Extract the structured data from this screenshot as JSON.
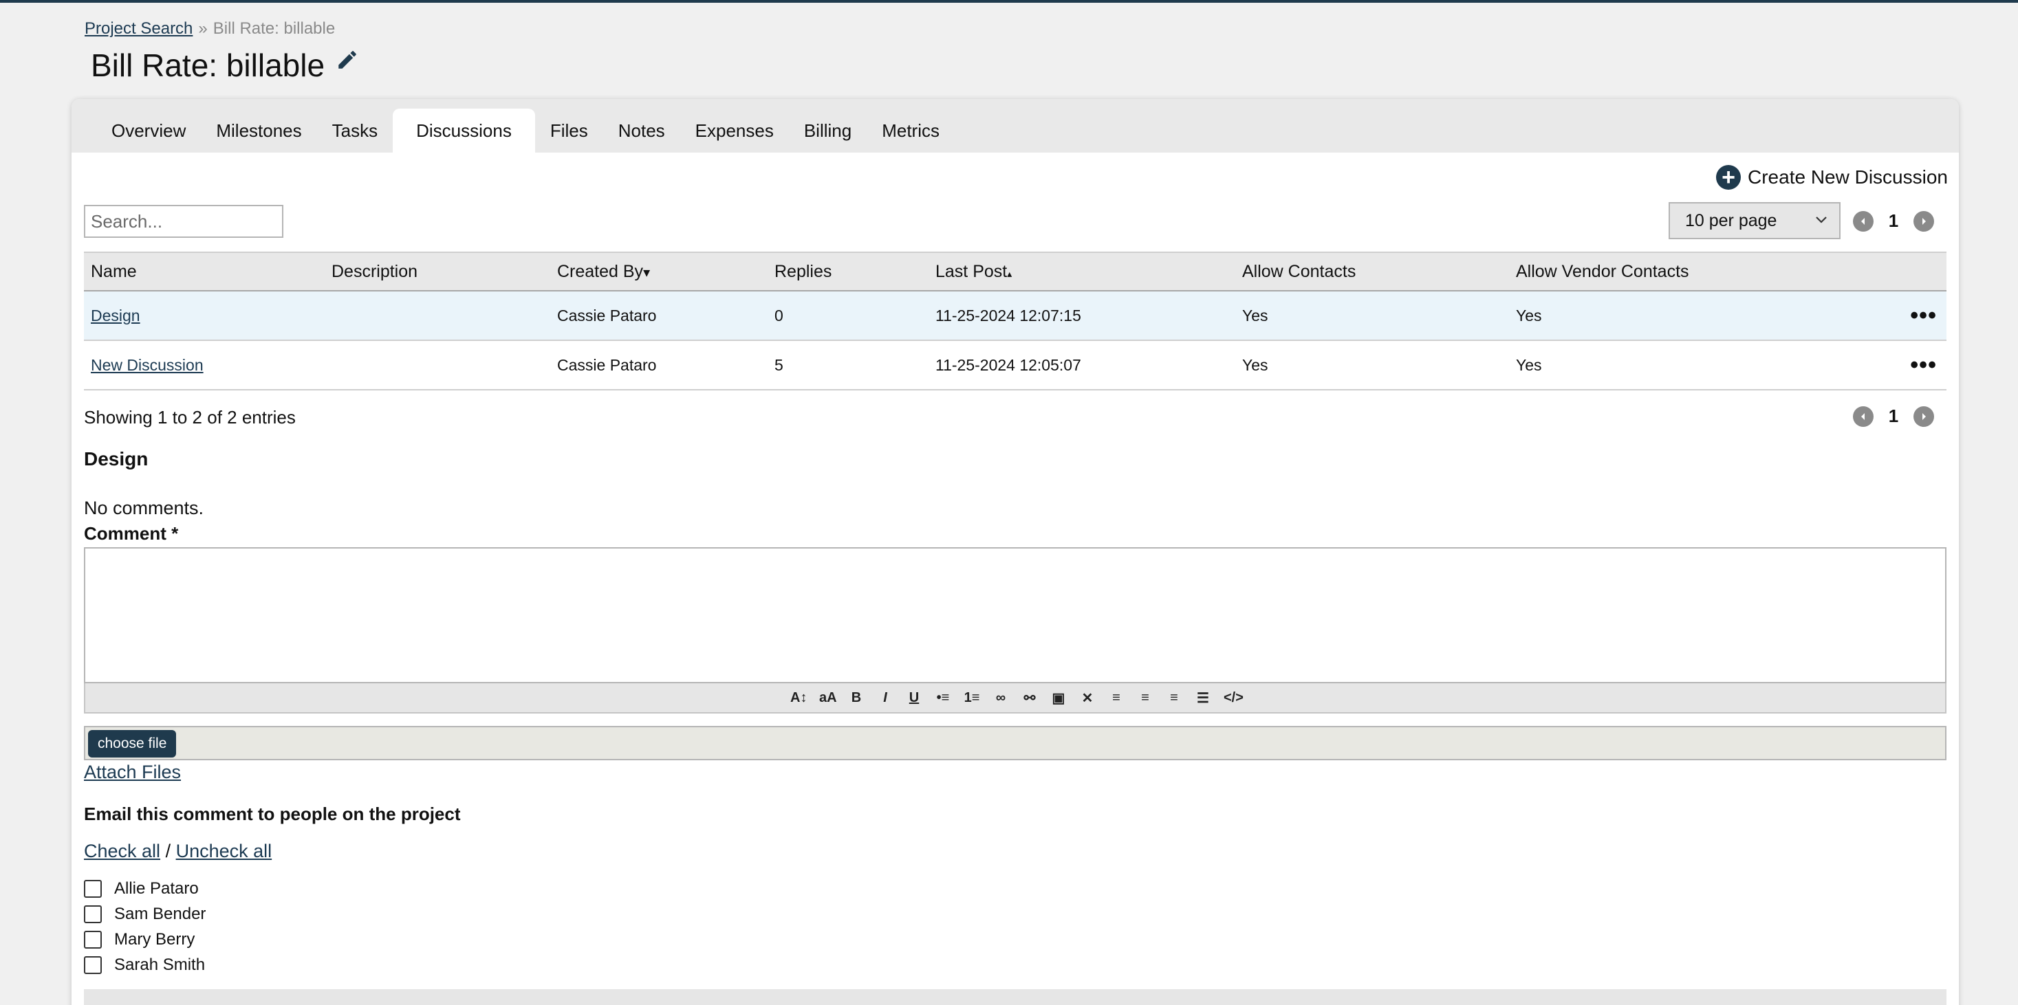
{
  "breadcrumb": {
    "link": "Project Search",
    "separator": "»",
    "current": "Bill Rate: billable"
  },
  "page_title": "Bill Rate: billable",
  "tabs": [
    {
      "label": "Overview"
    },
    {
      "label": "Milestones"
    },
    {
      "label": "Tasks"
    },
    {
      "label": "Discussions",
      "active": true
    },
    {
      "label": "Files"
    },
    {
      "label": "Notes"
    },
    {
      "label": "Expenses"
    },
    {
      "label": "Billing"
    },
    {
      "label": "Metrics"
    }
  ],
  "create_button": {
    "label": "Create New Discussion",
    "icon": "plus-circle-icon"
  },
  "search": {
    "placeholder": "Search..."
  },
  "per_page": {
    "selected": "10 per page"
  },
  "pager": {
    "current_page": "1"
  },
  "table": {
    "columns": [
      "Name",
      "Description",
      "Created By",
      "Replies",
      "Last Post",
      "Allow Contacts",
      "Allow Vendor Contacts"
    ],
    "sort_indicators": {
      "created_by": "▾",
      "last_post": "▴"
    },
    "rows": [
      {
        "name": "Design",
        "description": "",
        "created_by": "Cassie Pataro",
        "replies": "0",
        "last_post": "11-25-2024 12:07:15",
        "allow_contacts": "Yes",
        "allow_vendor": "Yes"
      },
      {
        "name": "New Discussion",
        "description": "",
        "created_by": "Cassie Pataro",
        "replies": "5",
        "last_post": "11-25-2024 12:05:07",
        "allow_contacts": "Yes",
        "allow_vendor": "Yes"
      }
    ],
    "row_menu": "•••"
  },
  "showing_text": "Showing 1 to 2 of 2 entries",
  "discussion": {
    "title": "Design",
    "no_comments": "No comments.",
    "comment_label": "Comment *"
  },
  "toolbar_icons": [
    "font-larger-icon",
    "font-smaller-icon",
    "bold-icon",
    "italic-icon",
    "underline-icon",
    "bullet-list-icon",
    "numbered-list-icon",
    "link-icon",
    "unlink-icon",
    "image-icon",
    "remove-format-icon",
    "align-left-icon",
    "align-center-icon",
    "align-right-icon",
    "justify-icon",
    "code-icon"
  ],
  "file": {
    "choose_label": "choose file",
    "attach_label": "Attach Files"
  },
  "email": {
    "title": "Email this comment to people on the project",
    "check_all": "Check all",
    "slash": "/",
    "uncheck_all": "Uncheck all",
    "people": [
      "Allie Pataro",
      "Sam Bender",
      "Mary Berry",
      "Sarah Smith"
    ]
  },
  "colors": {
    "accent": "#1f3a4d",
    "link": "#1c3a52",
    "row_highlight": "#eaf4fa"
  }
}
